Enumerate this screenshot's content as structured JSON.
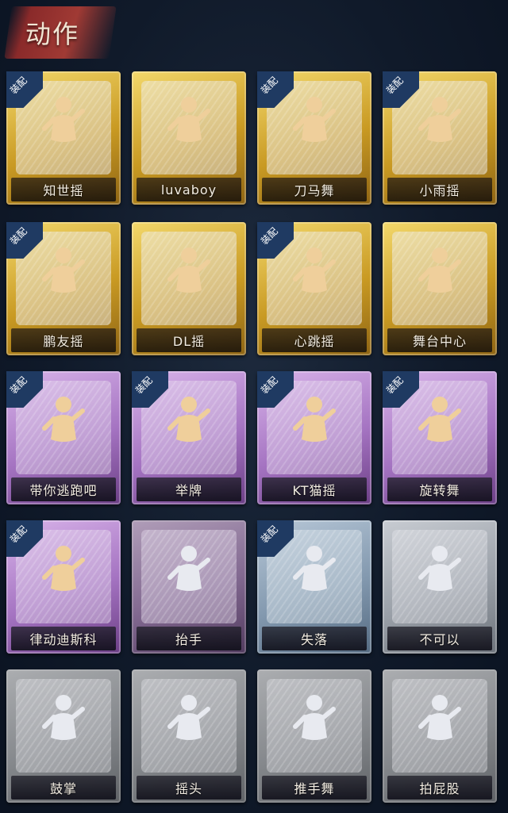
{
  "header": {
    "title": "动作"
  },
  "badge_label": "装配",
  "cards": [
    {
      "label": "知世摇",
      "equipped": true,
      "tier": "gold",
      "icon": "dance-pose-icon"
    },
    {
      "label": "luvaboy",
      "equipped": false,
      "tier": "gold",
      "icon": "dance-pose-icon"
    },
    {
      "label": "刀马舞",
      "equipped": true,
      "tier": "gold",
      "icon": "dance-pose-icon"
    },
    {
      "label": "小雨摇",
      "equipped": true,
      "tier": "gold",
      "icon": "dance-pose-icon"
    },
    {
      "label": "鹏友摇",
      "equipped": true,
      "tier": "gold",
      "icon": "dance-pose-icon"
    },
    {
      "label": "DL摇",
      "equipped": false,
      "tier": "gold",
      "icon": "dance-pose-icon"
    },
    {
      "label": "心跳摇",
      "equipped": true,
      "tier": "gold",
      "icon": "dance-pose-icon"
    },
    {
      "label": "舞台中心",
      "equipped": false,
      "tier": "gold",
      "icon": "dance-pose-icon"
    },
    {
      "label": "带你逃跑吧",
      "equipped": true,
      "tier": "purple",
      "icon": "dance-pose-icon"
    },
    {
      "label": "举牌",
      "equipped": true,
      "tier": "purple",
      "icon": "hold-sign-icon"
    },
    {
      "label": "KT猫摇",
      "equipped": true,
      "tier": "purple",
      "icon": "dance-pose-icon"
    },
    {
      "label": "旋转舞",
      "equipped": true,
      "tier": "purple",
      "icon": "spin-dance-icon"
    },
    {
      "label": "律动迪斯科",
      "equipped": true,
      "tier": "purple",
      "icon": "disco-pose-icon"
    },
    {
      "label": "抬手",
      "equipped": false,
      "tier": "purple",
      "icon": "raise-hand-icon",
      "locked": true
    },
    {
      "label": "失落",
      "equipped": true,
      "tier": "blue",
      "icon": "crawl-pose-icon"
    },
    {
      "label": "不可以",
      "equipped": false,
      "tier": "gray",
      "icon": "finger-wag-icon"
    },
    {
      "label": "鼓掌",
      "equipped": false,
      "tier": "gray",
      "icon": "clap-icon",
      "locked": true
    },
    {
      "label": "摇头",
      "equipped": false,
      "tier": "gray",
      "icon": "shake-head-icon",
      "locked": true
    },
    {
      "label": "推手舞",
      "equipped": false,
      "tier": "gray",
      "icon": "push-hands-icon",
      "locked": true
    },
    {
      "label": "拍屁股",
      "equipped": false,
      "tier": "gray",
      "icon": "pat-icon",
      "locked": true
    }
  ]
}
